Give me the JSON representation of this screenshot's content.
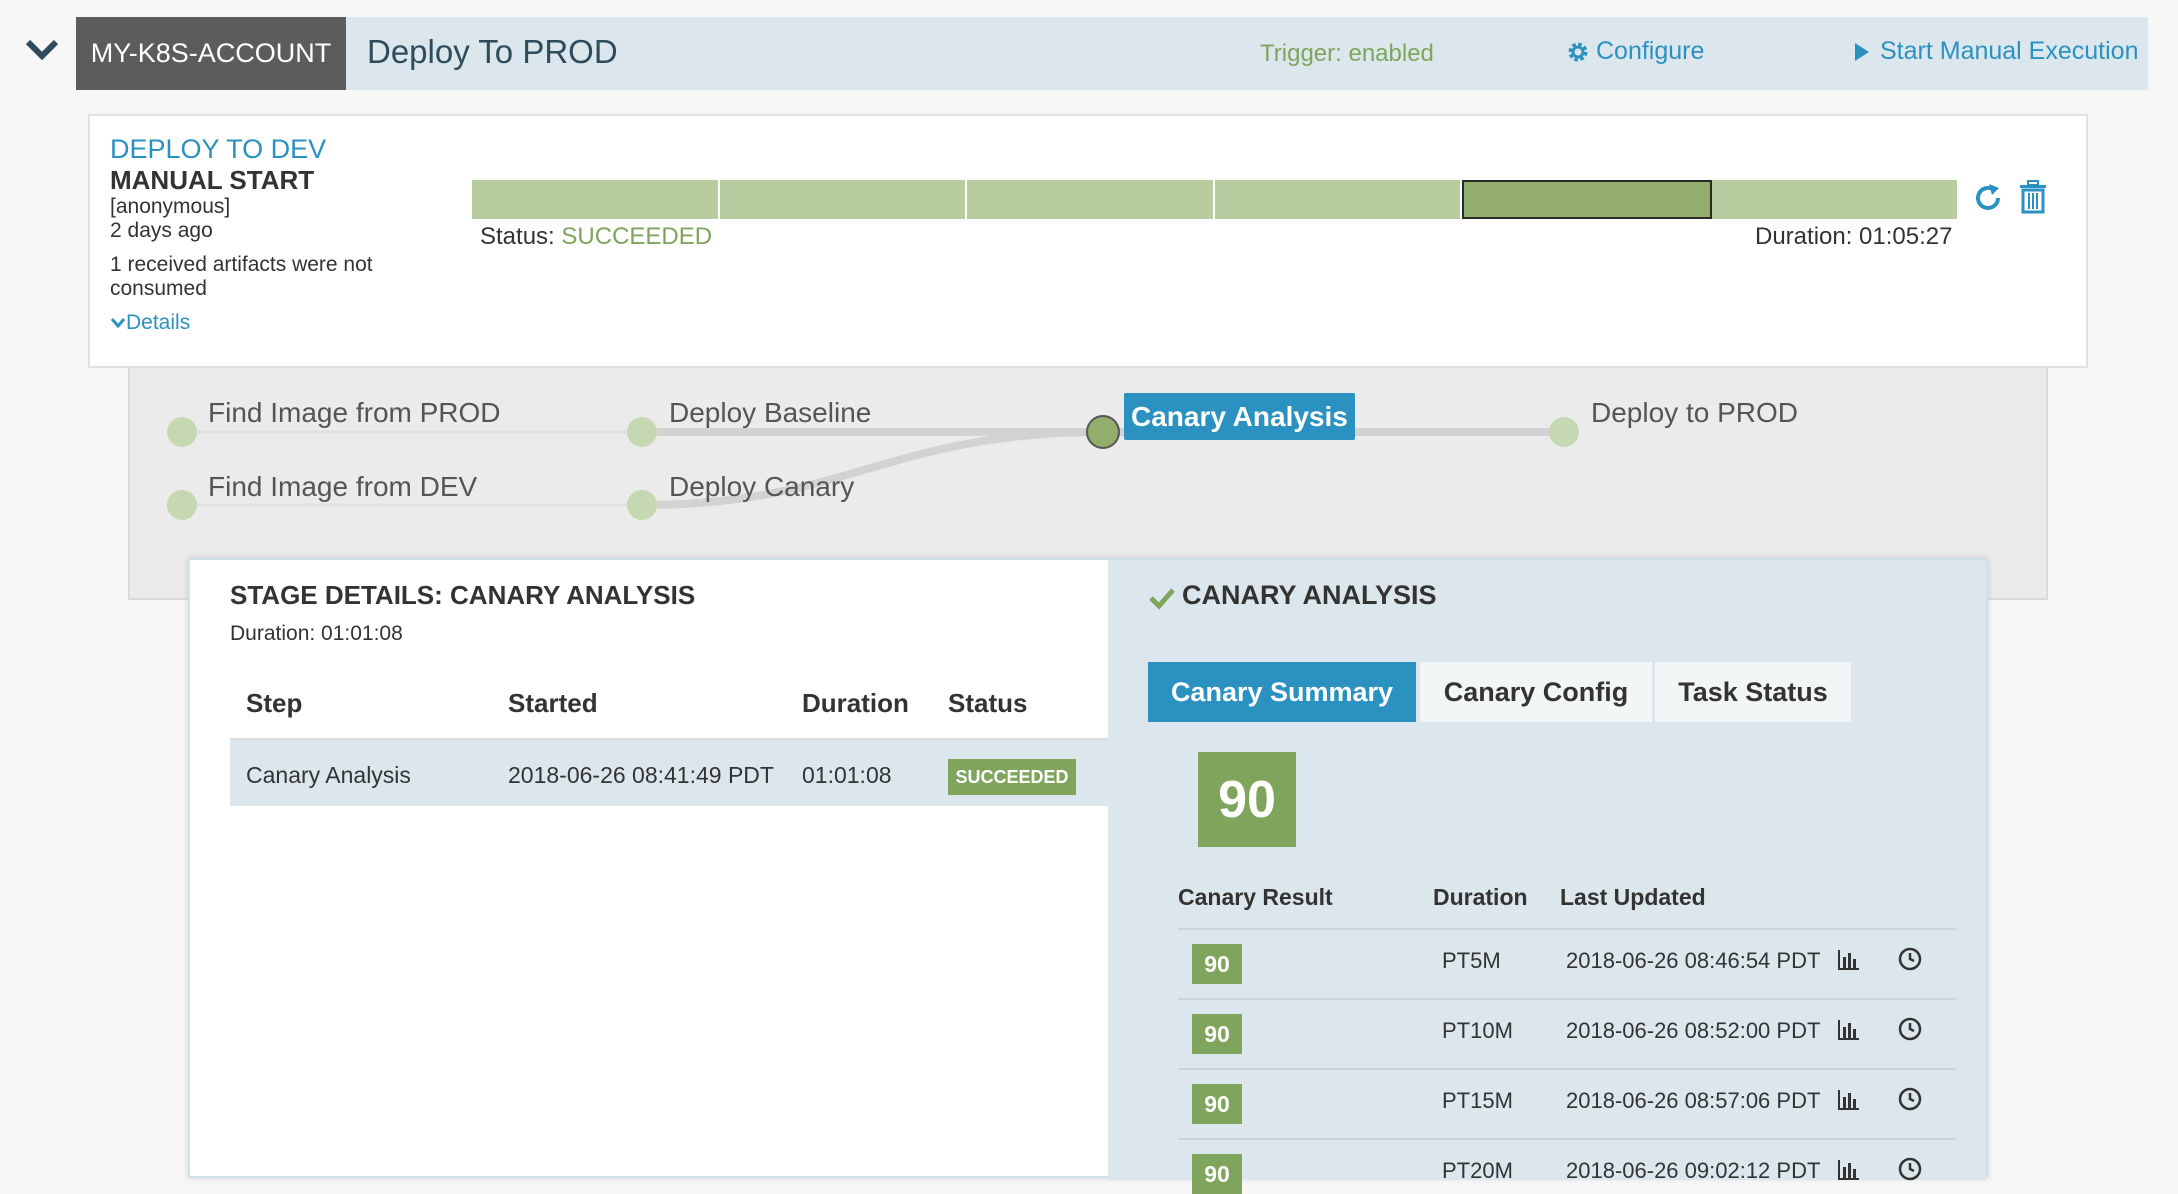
{
  "header": {
    "account": "MY-K8S-ACCOUNT",
    "pipeline_name": "Deploy To PROD",
    "trigger": "Trigger: enabled",
    "configure": "Configure",
    "start_manual": "Start Manual Execution"
  },
  "execution": {
    "title": "DEPLOY TO DEV",
    "trigger_type": "MANUAL START",
    "user": "[anonymous]",
    "time_ago": "2 days ago",
    "artifacts_note": "1 received artifacts were not consumed",
    "details_link": "Details",
    "status_label": "Status:",
    "status_value": "SUCCEEDED",
    "duration": "Duration: 01:05:27",
    "stage_count": 6,
    "active_stage_index": 4
  },
  "graph": {
    "nodes": [
      {
        "label": "Find Image from PROD"
      },
      {
        "label": "Find Image from DEV"
      },
      {
        "label": "Deploy Baseline"
      },
      {
        "label": "Deploy Canary"
      },
      {
        "label": "Canary Analysis"
      },
      {
        "label": "Deploy to PROD"
      }
    ]
  },
  "stage_details": {
    "title": "STAGE DETAILS: CANARY ANALYSIS",
    "duration": "Duration: 01:01:08",
    "columns": [
      "Step",
      "Started",
      "Duration",
      "Status"
    ],
    "rows": [
      {
        "step": "Canary Analysis",
        "started": "2018-06-26 08:41:49 PDT",
        "duration": "01:01:08",
        "status": "SUCCEEDED"
      }
    ]
  },
  "canary": {
    "heading": "CANARY ANALYSIS",
    "tabs": [
      "Canary Summary",
      "Canary Config",
      "Task Status"
    ],
    "score": "90",
    "columns": [
      "Canary Result",
      "Duration",
      "Last Updated"
    ],
    "results": [
      {
        "score": "90",
        "duration": "PT5M",
        "updated": "2018-06-26 08:46:54 PDT"
      },
      {
        "score": "90",
        "duration": "PT10M",
        "updated": "2018-06-26 08:52:00 PDT"
      },
      {
        "score": "90",
        "duration": "PT15M",
        "updated": "2018-06-26 08:57:06 PDT"
      },
      {
        "score": "90",
        "duration": "PT20M",
        "updated": "2018-06-26 09:02:12 PDT"
      }
    ]
  },
  "colors": {
    "accent": "#2b91c0",
    "success": "#7fa55c",
    "header_bg": "#dbe7ec",
    "account_bg": "#5c5c5c"
  },
  "icons": [
    "chevron-down-icon",
    "gear-icon",
    "play-icon",
    "refresh-icon",
    "trash-icon",
    "check-icon",
    "bar-chart-icon",
    "clock-icon"
  ]
}
